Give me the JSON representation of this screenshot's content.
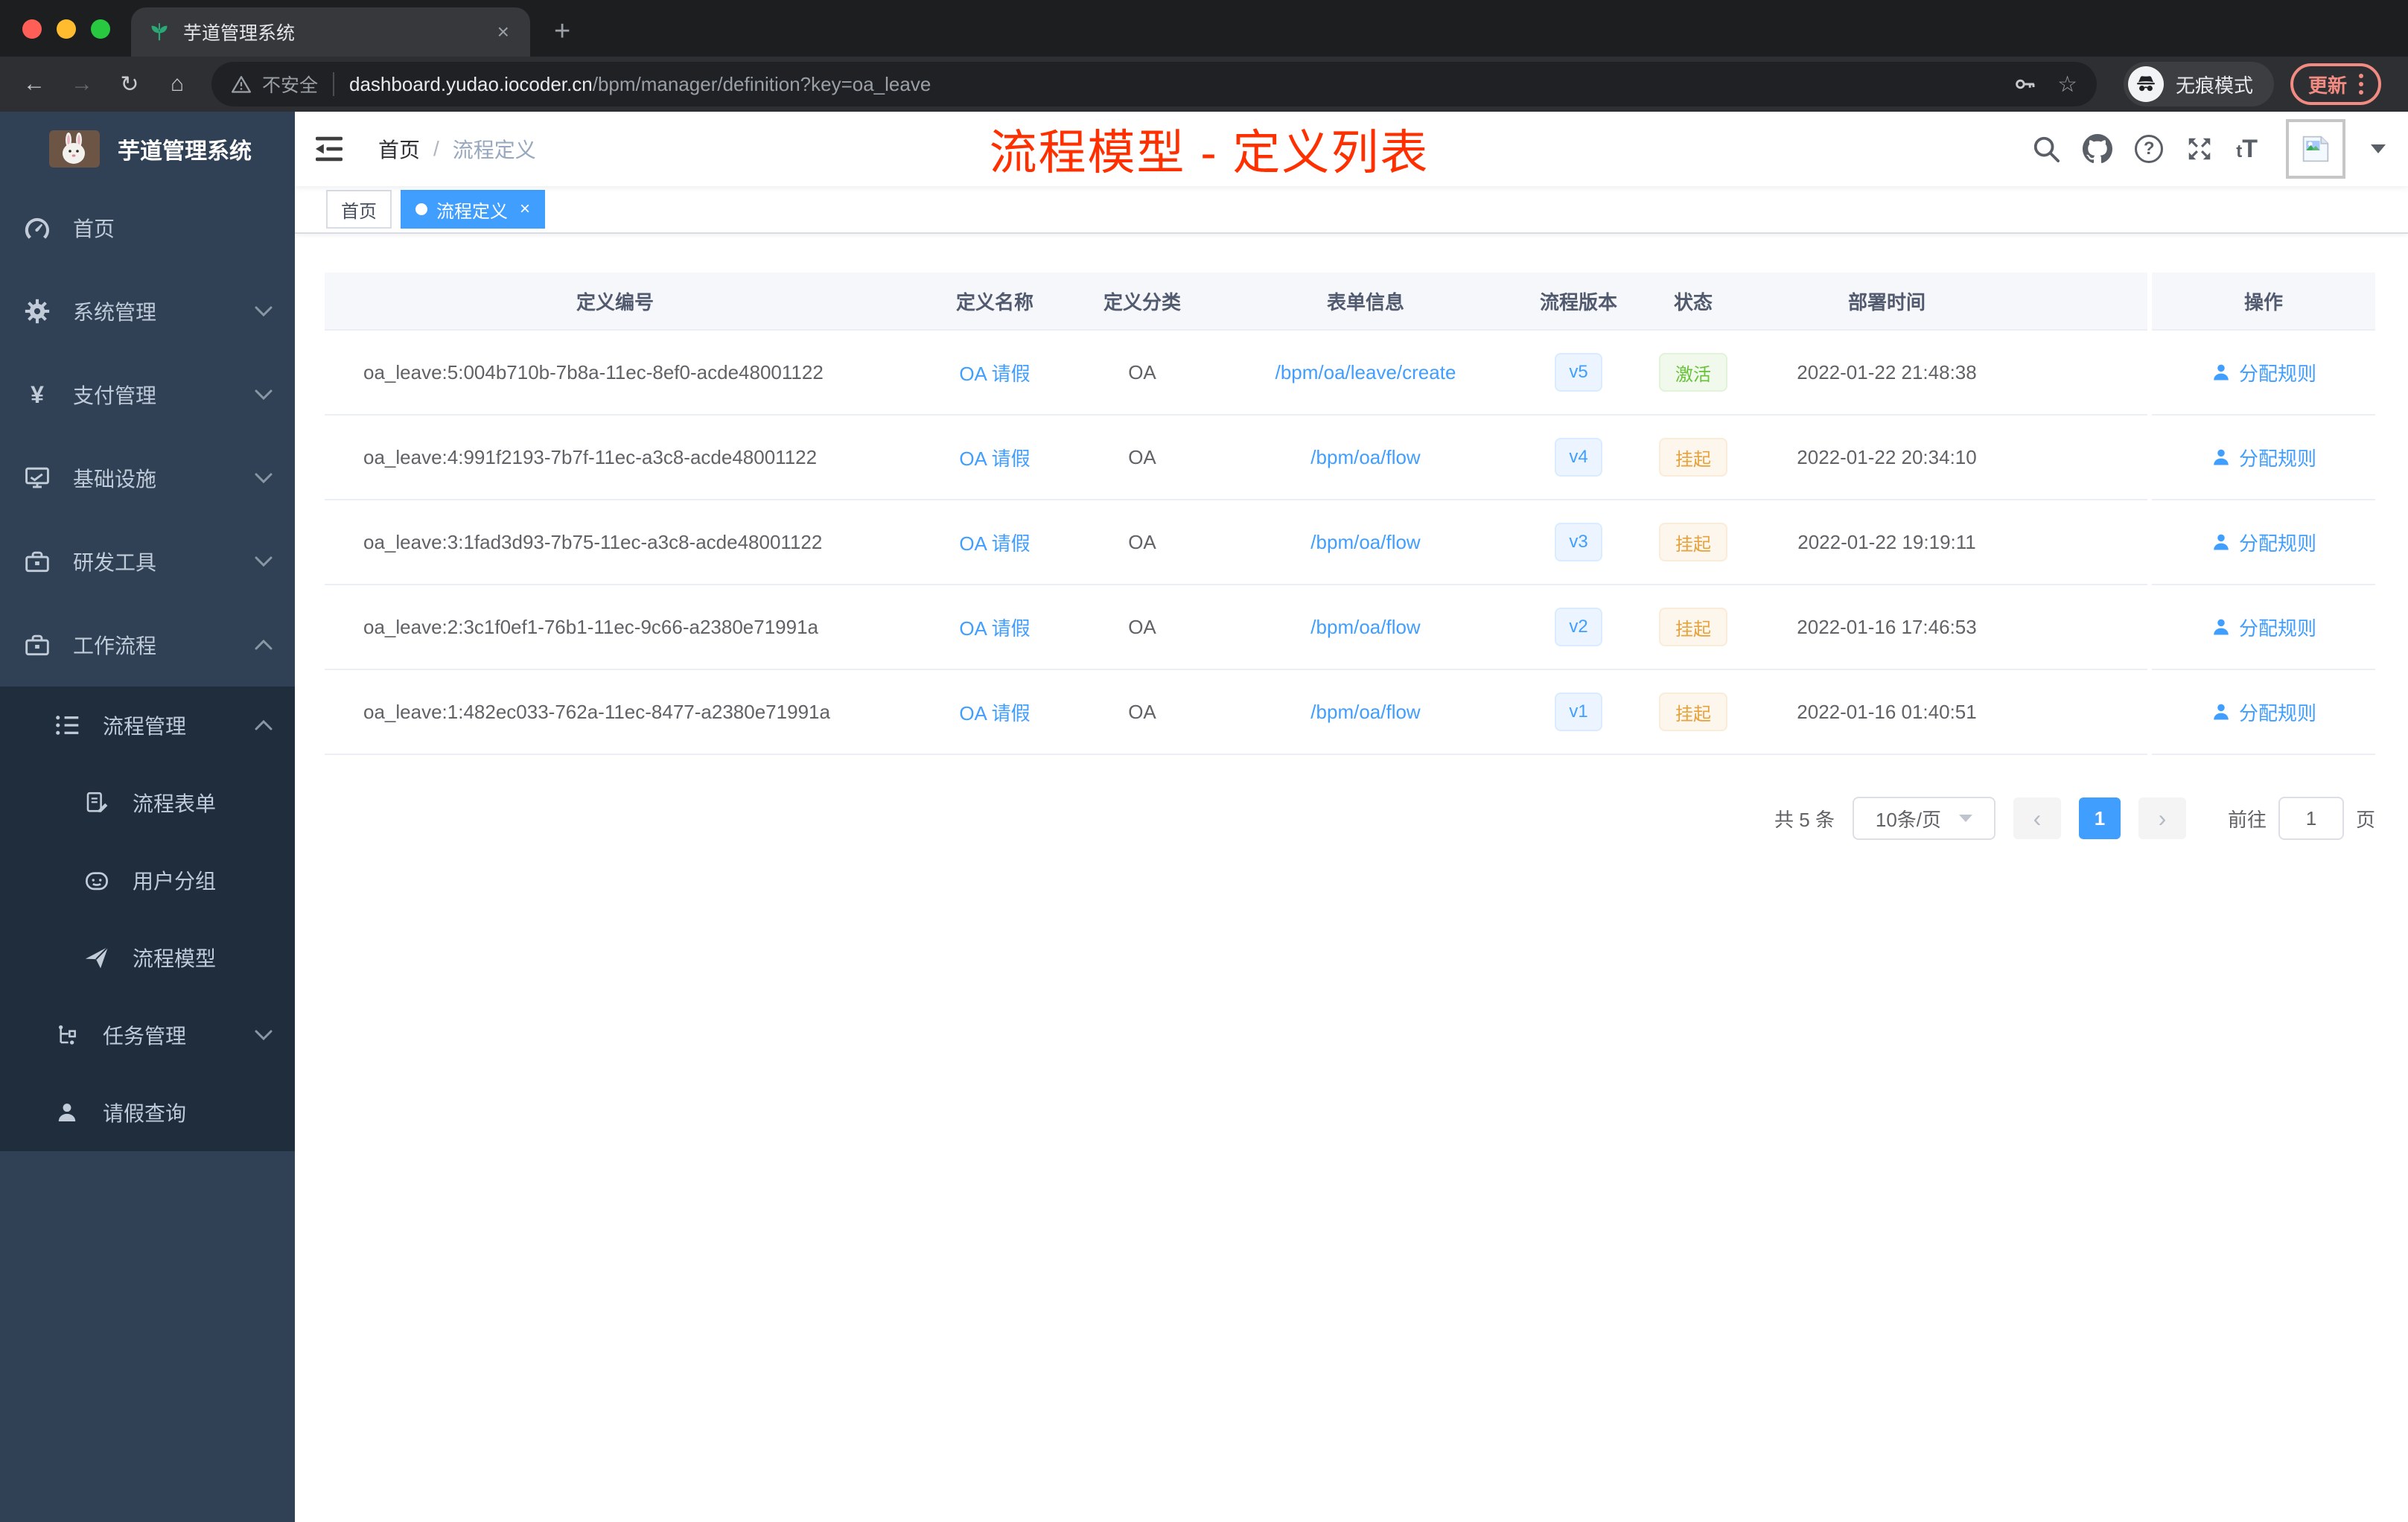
{
  "colors": {
    "accent": "#409eff",
    "success": "#67c23a",
    "warning": "#e6a23c",
    "annotation_red": "#ff3000",
    "sidebar_bg": "#304156",
    "submenu_bg": "#1f2d3d"
  },
  "browser": {
    "tab": {
      "favicon": "seedling-icon",
      "title": "芋道管理系统",
      "close_glyph": "×"
    },
    "new_tab_glyph": "+",
    "nav": {
      "back_glyph": "←",
      "forward_glyph": "→",
      "reload_glyph": "↻",
      "home_glyph": "⌂"
    },
    "address": {
      "warning_icon": "warning-triangle-icon",
      "warning_text": "不安全",
      "host": "dashboard.yudao.iocoder.cn",
      "path": "/bpm/manager/definition?key=oa_leave",
      "key_icon": "key-icon",
      "star_glyph": "☆"
    },
    "incognito": {
      "icon": "incognito-icon",
      "label": "无痕模式"
    },
    "update": {
      "label": "更新",
      "menu_icon": "vertical-dots-icon"
    }
  },
  "sidebar": {
    "logo": {
      "image": "rabbit-avatar",
      "title": "芋道管理系统"
    },
    "items": [
      {
        "icon": "dashboard-icon",
        "label": "首页",
        "level": 1
      },
      {
        "icon": "gear-icon",
        "label": "系统管理",
        "level": 1,
        "chevron": "down"
      },
      {
        "icon": "yen-icon",
        "glyph": "¥",
        "label": "支付管理",
        "level": 1,
        "chevron": "down"
      },
      {
        "icon": "monitor-icon",
        "label": "基础设施",
        "level": 1,
        "chevron": "down"
      },
      {
        "icon": "toolbox-icon",
        "label": "研发工具",
        "level": 1,
        "chevron": "down"
      },
      {
        "icon": "briefcase-icon",
        "label": "工作流程",
        "level": 1,
        "chevron": "up"
      },
      {
        "icon": "list-icon",
        "label": "流程管理",
        "level": 2,
        "chevron": "up"
      },
      {
        "icon": "form-icon",
        "label": "流程表单",
        "level": 3
      },
      {
        "icon": "robot-icon",
        "label": "用户分组",
        "level": 3
      },
      {
        "icon": "paper-plane-icon",
        "label": "流程模型",
        "level": 3
      },
      {
        "icon": "flow-tree-icon",
        "label": "任务管理",
        "level": 2,
        "chevron": "down"
      },
      {
        "icon": "user-icon",
        "label": "请假查询",
        "level": 2
      }
    ]
  },
  "header": {
    "breadcrumb": {
      "home": "首页",
      "separator": "/",
      "current": "流程定义"
    },
    "annotation": "流程模型 - 定义列表",
    "help_glyph": "?",
    "font_size_glyph": "tT",
    "icons": [
      "search-icon",
      "github-icon",
      "help-icon",
      "fullscreen-icon",
      "font-size-icon",
      "broken-image-avatar",
      "chevron-down-caret"
    ]
  },
  "tags": {
    "items": [
      {
        "label": "首页",
        "active": false
      },
      {
        "label": "流程定义",
        "active": true,
        "close_glyph": "×"
      }
    ]
  },
  "table": {
    "columns": [
      "定义编号",
      "定义名称",
      "定义分类",
      "表单信息",
      "流程版本",
      "状态",
      "部署时间",
      "操作"
    ],
    "rows": [
      {
        "id": "oa_leave:5:004b710b-7b8a-11ec-8ef0-acde48001122",
        "name": "OA 请假",
        "category": "OA",
        "form": "/bpm/oa/leave/create",
        "version": "v5",
        "status": "激活",
        "status_type": "success",
        "deploy_time": "2022-01-22 21:48:38",
        "action": "分配规则"
      },
      {
        "id": "oa_leave:4:991f2193-7b7f-11ec-a3c8-acde48001122",
        "name": "OA 请假",
        "category": "OA",
        "form": "/bpm/oa/flow",
        "version": "v4",
        "status": "挂起",
        "status_type": "warning",
        "deploy_time": "2022-01-22 20:34:10",
        "action": "分配规则"
      },
      {
        "id": "oa_leave:3:1fad3d93-7b75-11ec-a3c8-acde48001122",
        "name": "OA 请假",
        "category": "OA",
        "form": "/bpm/oa/flow",
        "version": "v3",
        "status": "挂起",
        "status_type": "warning",
        "deploy_time": "2022-01-22 19:19:11",
        "action": "分配规则"
      },
      {
        "id": "oa_leave:2:3c1f0ef1-76b1-11ec-9c66-a2380e71991a",
        "name": "OA 请假",
        "category": "OA",
        "form": "/bpm/oa/flow",
        "version": "v2",
        "status": "挂起",
        "status_type": "warning",
        "deploy_time": "2022-01-16 17:46:53",
        "action": "分配规则"
      },
      {
        "id": "oa_leave:1:482ec033-762a-11ec-8477-a2380e71991a",
        "name": "OA 请假",
        "category": "OA",
        "form": "/bpm/oa/flow",
        "version": "v1",
        "status": "挂起",
        "status_type": "warning",
        "deploy_time": "2022-01-16 01:40:51",
        "action": "分配规则"
      }
    ]
  },
  "pagination": {
    "total": "共 5 条",
    "page_size": "10条/页",
    "prev_glyph": "‹",
    "current_page": "1",
    "next_glyph": "›",
    "goto_label": "前往",
    "goto_value": "1",
    "unit_label": "页"
  }
}
